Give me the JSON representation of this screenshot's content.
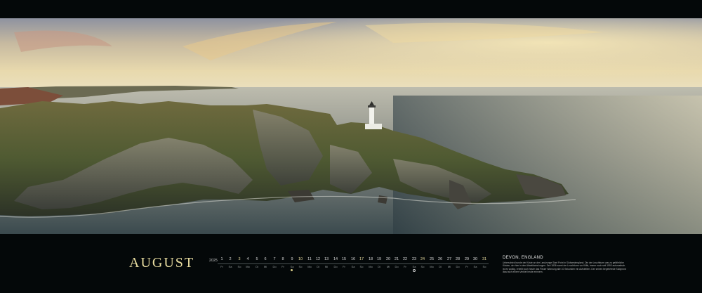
{
  "calendar": {
    "month": "AUGUST",
    "year": "2025",
    "days": [
      {
        "d": "1",
        "w": "Fr"
      },
      {
        "d": "2",
        "w": "Sa"
      },
      {
        "d": "3",
        "w": "So"
      },
      {
        "d": "4",
        "w": "Mo"
      },
      {
        "d": "5",
        "w": "Di"
      },
      {
        "d": "6",
        "w": "Mi"
      },
      {
        "d": "7",
        "w": "Do"
      },
      {
        "d": "8",
        "w": "Fr"
      },
      {
        "d": "9",
        "w": "Sa"
      },
      {
        "d": "10",
        "w": "So"
      },
      {
        "d": "11",
        "w": "Mo"
      },
      {
        "d": "12",
        "w": "Di"
      },
      {
        "d": "13",
        "w": "Mi"
      },
      {
        "d": "14",
        "w": "Do"
      },
      {
        "d": "15",
        "w": "Fr"
      },
      {
        "d": "16",
        "w": "Sa"
      },
      {
        "d": "17",
        "w": "So"
      },
      {
        "d": "18",
        "w": "Mo"
      },
      {
        "d": "19",
        "w": "Di"
      },
      {
        "d": "20",
        "w": "Mi"
      },
      {
        "d": "21",
        "w": "Do"
      },
      {
        "d": "22",
        "w": "Fr"
      },
      {
        "d": "23",
        "w": "Sa"
      },
      {
        "d": "24",
        "w": "So"
      },
      {
        "d": "25",
        "w": "Mo"
      },
      {
        "d": "26",
        "w": "Di"
      },
      {
        "d": "27",
        "w": "Mi"
      },
      {
        "d": "28",
        "w": "Do"
      },
      {
        "d": "29",
        "w": "Fr"
      },
      {
        "d": "30",
        "w": "Sa"
      },
      {
        "d": "31",
        "w": "So"
      }
    ],
    "moon_full_day": 9,
    "moon_new_day": 23
  },
  "caption": {
    "title": "DEVON, ENGLAND",
    "body": "Unterschied bunde der Küste an der Landzunge Start Point in Südwestengland. Die der Leuchtturm war zu gefährliche Küsten, der hier in den Atlantikwind ragen. Seit 1836 warnt der Leuchtturm vor Kliffs, immer noch seit 1993 automatisch. Ist es wolkig, erhellt noch heute das Fieuer Warnung alle 10 Sekunden ein Aufstellten. Der seinen begehrteste Südgrund lässt sich einem Verklet heute erinnern."
  },
  "colors": {
    "accent": "#e8dca0",
    "background": "#040809"
  }
}
